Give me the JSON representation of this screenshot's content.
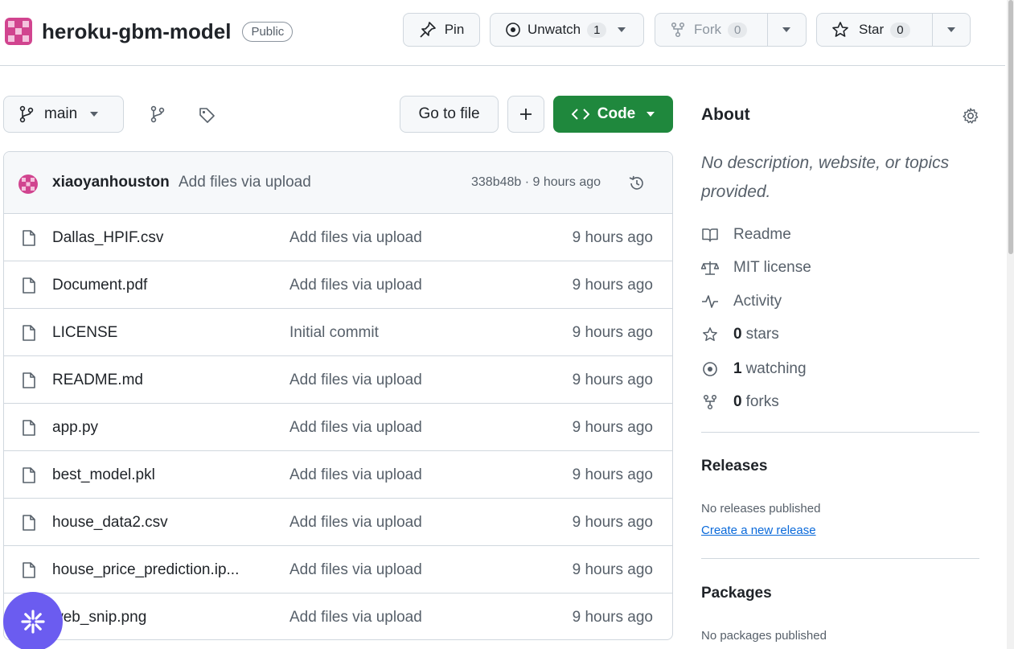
{
  "repo": {
    "name": "heroku-gbm-model",
    "visibility": "Public"
  },
  "actions": {
    "pin_label": "Pin",
    "unwatch_label": "Unwatch",
    "unwatch_count": "1",
    "fork_label": "Fork",
    "fork_count": "0",
    "star_label": "Star",
    "star_count": "0"
  },
  "toolbar": {
    "branch": "main",
    "goto_file": "Go to file",
    "code_label": "Code"
  },
  "commit": {
    "author": "xiaoyanhouston",
    "message": "Add files via upload",
    "meta": "338b48b · 9 hours ago"
  },
  "files": [
    {
      "name": "Dallas_HPIF.csv",
      "message": "Add files via upload",
      "time": "9 hours ago"
    },
    {
      "name": "Document.pdf",
      "message": "Add files via upload",
      "time": "9 hours ago"
    },
    {
      "name": "LICENSE",
      "message": "Initial commit",
      "time": "9 hours ago"
    },
    {
      "name": "README.md",
      "message": "Add files via upload",
      "time": "9 hours ago"
    },
    {
      "name": "app.py",
      "message": "Add files via upload",
      "time": "9 hours ago"
    },
    {
      "name": "best_model.pkl",
      "message": "Add files via upload",
      "time": "9 hours ago"
    },
    {
      "name": "house_data2.csv",
      "message": "Add files via upload",
      "time": "9 hours ago"
    },
    {
      "name": "house_price_prediction.ip...",
      "message": "Add files via upload",
      "time": "9 hours ago"
    },
    {
      "name": "web_snip.png",
      "message": "Add files via upload",
      "time": "9 hours ago"
    }
  ],
  "about": {
    "title": "About",
    "description": "No description, website, or topics provided.",
    "readme": "Readme",
    "license": "MIT license",
    "activity": "Activity",
    "stars_count": "0",
    "stars_label": "stars",
    "watching_count": "1",
    "watching_label": "watching",
    "forks_count": "0",
    "forks_label": "forks"
  },
  "releases": {
    "title": "Releases",
    "empty": "No releases published",
    "create_link": "Create a new release"
  },
  "packages": {
    "title": "Packages",
    "empty": "No packages published"
  },
  "colors": {
    "accent_green": "#1f883d",
    "link_blue": "#0969da",
    "avatar_pink": "#d1448f",
    "fab_purple": "#6b5cf0"
  },
  "icons": [
    "pin-icon",
    "eye-icon",
    "fork-icon",
    "star-icon",
    "branch-icon",
    "tag-icon",
    "plus-icon",
    "code-icon",
    "history-icon",
    "file-icon",
    "gear-icon",
    "book-icon",
    "scale-icon",
    "pulse-icon"
  ]
}
